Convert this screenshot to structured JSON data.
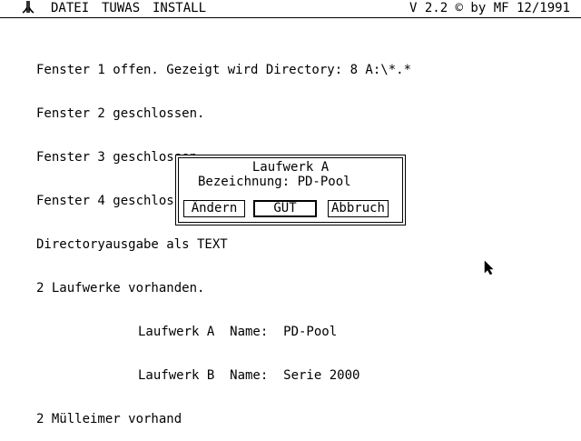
{
  "menubar": {
    "logo_icon": "atari-fuji-icon",
    "menus": [
      "DATEI",
      "TUWAS",
      "INSTALL"
    ],
    "version": "V 2.2 © by MF 12/1991"
  },
  "console": {
    "lines": [
      "Fenster 1 offen. Gezeigt wird Directory: 8 A:\\*.*",
      "Fenster 2 geschlossen.",
      "Fenster 3 geschlossen.",
      "Fenster 4 geschlossen.",
      "Directoryausgabe als TEXT",
      "2 Laufwerke vorhanden.",
      "Laufwerk A  Name:  PD-Pool",
      "Laufwerk B  Name:  Serie 2000",
      "2 Mülleimer vorhand"
    ]
  },
  "dialog": {
    "title": "Laufwerk A",
    "field": "Bezeichnung: PD-Pool",
    "buttons": {
      "change": "Ändern",
      "ok": "GUT",
      "cancel": "Abbruch"
    }
  },
  "cursor_icon": "mouse-pointer-icon"
}
